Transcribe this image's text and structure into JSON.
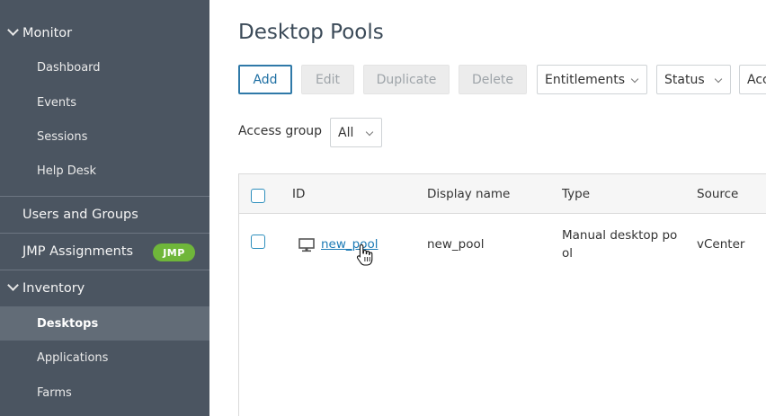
{
  "sidebar": {
    "monitor": {
      "label": "Monitor",
      "icon": "chevron-down-icon",
      "items": [
        "Dashboard",
        "Events",
        "Sessions",
        "Help Desk"
      ]
    },
    "users_groups": "Users and Groups",
    "jmp": {
      "label": "JMP Assignments",
      "badge": "JMP"
    },
    "inventory": {
      "label": "Inventory",
      "icon": "chevron-down-icon",
      "items": [
        "Desktops",
        "Applications",
        "Farms"
      ],
      "active": "Desktops"
    }
  },
  "page": {
    "title": "Desktop Pools"
  },
  "toolbar": {
    "add": "Add",
    "edit": "Edit",
    "duplicate": "Duplicate",
    "delete": "Delete",
    "entitlements": "Entitlements",
    "status": "Status",
    "truncated": "Acc"
  },
  "access_group": {
    "label": "Access group",
    "value": "All"
  },
  "table": {
    "columns": [
      "ID",
      "Display name",
      "Type",
      "Source"
    ],
    "rows": [
      {
        "id": "new_pool",
        "display_name": "new_pool",
        "type_line1": "Manual desktop po",
        "type_line2": "ol",
        "source": "vCenter",
        "icon": "desktop-monitor-icon"
      }
    ]
  },
  "colors": {
    "sidebar_bg": "#4b5561",
    "sidebar_active": "#626c77",
    "accent": "#1b7ab5",
    "badge": "#6fb63a"
  }
}
